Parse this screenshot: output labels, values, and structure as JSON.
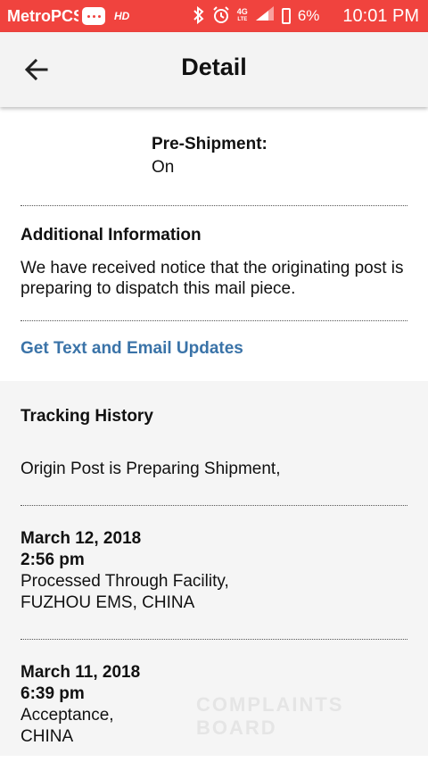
{
  "status_bar": {
    "carrier": "MetroPCS",
    "hd": "HD",
    "network": "4G",
    "network_sub": "LTE",
    "battery": "6%",
    "time": "10:01 PM",
    "icons": [
      "message-icon",
      "bluetooth-icon",
      "alarm-icon",
      "signal-icon",
      "battery-icon"
    ]
  },
  "header": {
    "title": "Detail"
  },
  "pre_shipment": {
    "label": "Pre-Shipment:",
    "value": "On"
  },
  "additional_info": {
    "heading": "Additional Information",
    "text": "We have received notice that the originating post is preparing to dispatch this mail piece."
  },
  "updates_link": "Get Text and Email Updates",
  "tracking": {
    "heading": "Tracking History",
    "events": [
      {
        "date": "",
        "time": "",
        "status": "Origin Post is Preparing Shipment,",
        "location": ""
      },
      {
        "date": "March 12, 2018",
        "time": "2:56 pm",
        "status": "Processed Through Facility,",
        "location": "FUZHOU EMS, CHINA"
      },
      {
        "date": "March 11, 2018",
        "time": "6:39 pm",
        "status": "Acceptance,",
        "location": "CHINA"
      }
    ]
  },
  "watermark": "COMPLAINTS BOARD",
  "colors": {
    "status_bar": "#f0433e",
    "link": "#3a73a8",
    "history_bg": "#f5f5f5"
  }
}
